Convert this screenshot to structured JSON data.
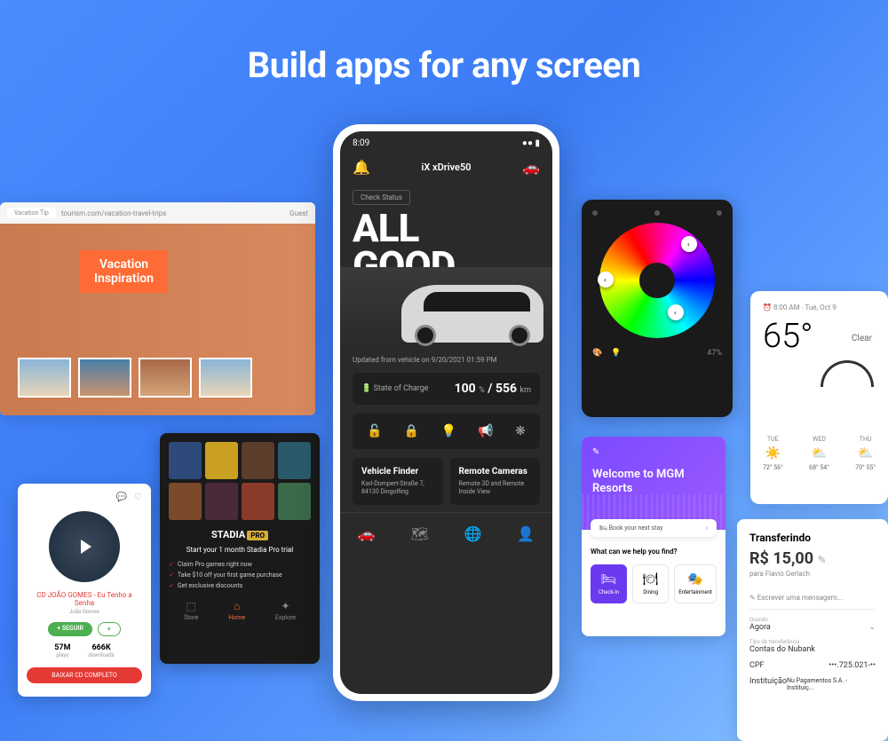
{
  "headline": "Build apps for any screen",
  "browser": {
    "tab": "Vacation Tip",
    "url": "tourism.com/vacation-travel-trips",
    "guest": "Guest",
    "banner_line1": "Vacation",
    "banner_line2": "Inspiration"
  },
  "stadia": {
    "brand": "STADIA",
    "pro": "PRO",
    "headline": "Start your 1 month Stadia Pro trial",
    "bullets": [
      "Claim Pro games right now",
      "Take $10 off your first game purchase",
      "Get exclusive discounts"
    ],
    "nav": [
      "Store",
      "Home",
      "Explore"
    ]
  },
  "music": {
    "title": "CD JOÃO GOMES - Eu Tenho a Senha",
    "subtitle": "João Gomes",
    "follow": "+ SEGUIR",
    "plus": "+",
    "stat1_num": "57M",
    "stat1_lbl": "plays",
    "stat2_num": "666K",
    "stat2_lbl": "downloads",
    "download": "BAIXAR CD COMPLETO"
  },
  "phone": {
    "time": "8:09",
    "title": "iX xDrive50",
    "check": "Check Status",
    "all": "ALL",
    "good": "GOOD",
    "updated": "Updated from vehicle on 9/20/2021 01:59 PM",
    "charge_label": "State of Charge",
    "charge_pct": "100",
    "charge_pct_unit": "%",
    "charge_sep": "/",
    "charge_km": "556",
    "charge_km_unit": "km",
    "finder_title": "Vehicle Finder",
    "finder_sub": "Karl-Dompert-Straße 7, 84130 Dingolfing",
    "cameras_title": "Remote Cameras",
    "cameras_sub": "Remote 3D and Remote Inside View"
  },
  "color": {
    "pct": "47%"
  },
  "weather": {
    "time": "8:00 AM · Tue, Oct 9",
    "temp": "65°",
    "cond": "Clear",
    "days": [
      {
        "day": "TUE",
        "hi": "72°",
        "lo": "56°"
      },
      {
        "day": "WED",
        "hi": "68°",
        "lo": "54°"
      },
      {
        "day": "THU",
        "hi": "70°",
        "lo": "55°"
      }
    ]
  },
  "mgm": {
    "welcome": "Welcome to MGM Resorts",
    "book": "Book your next stay",
    "help": "What can we help you find?",
    "tiles": [
      "Check-In",
      "Dining",
      "Entertainment"
    ]
  },
  "transfer": {
    "title": "Transferindo",
    "amount": "R$ 15,00",
    "to": "para Flavio Gerlach",
    "msg": "Escrever uma mensagem...",
    "when_lbl": "Quando",
    "when_val": "Agora",
    "type_lbl": "Tipo de transferência",
    "type_val": "Contas do Nubank",
    "cpf_lbl": "CPF",
    "cpf_val": "•••.725.021-••",
    "inst_lbl": "Instituição",
    "inst_val": "Nu Pagamentos S.A. - Instituiç..."
  }
}
